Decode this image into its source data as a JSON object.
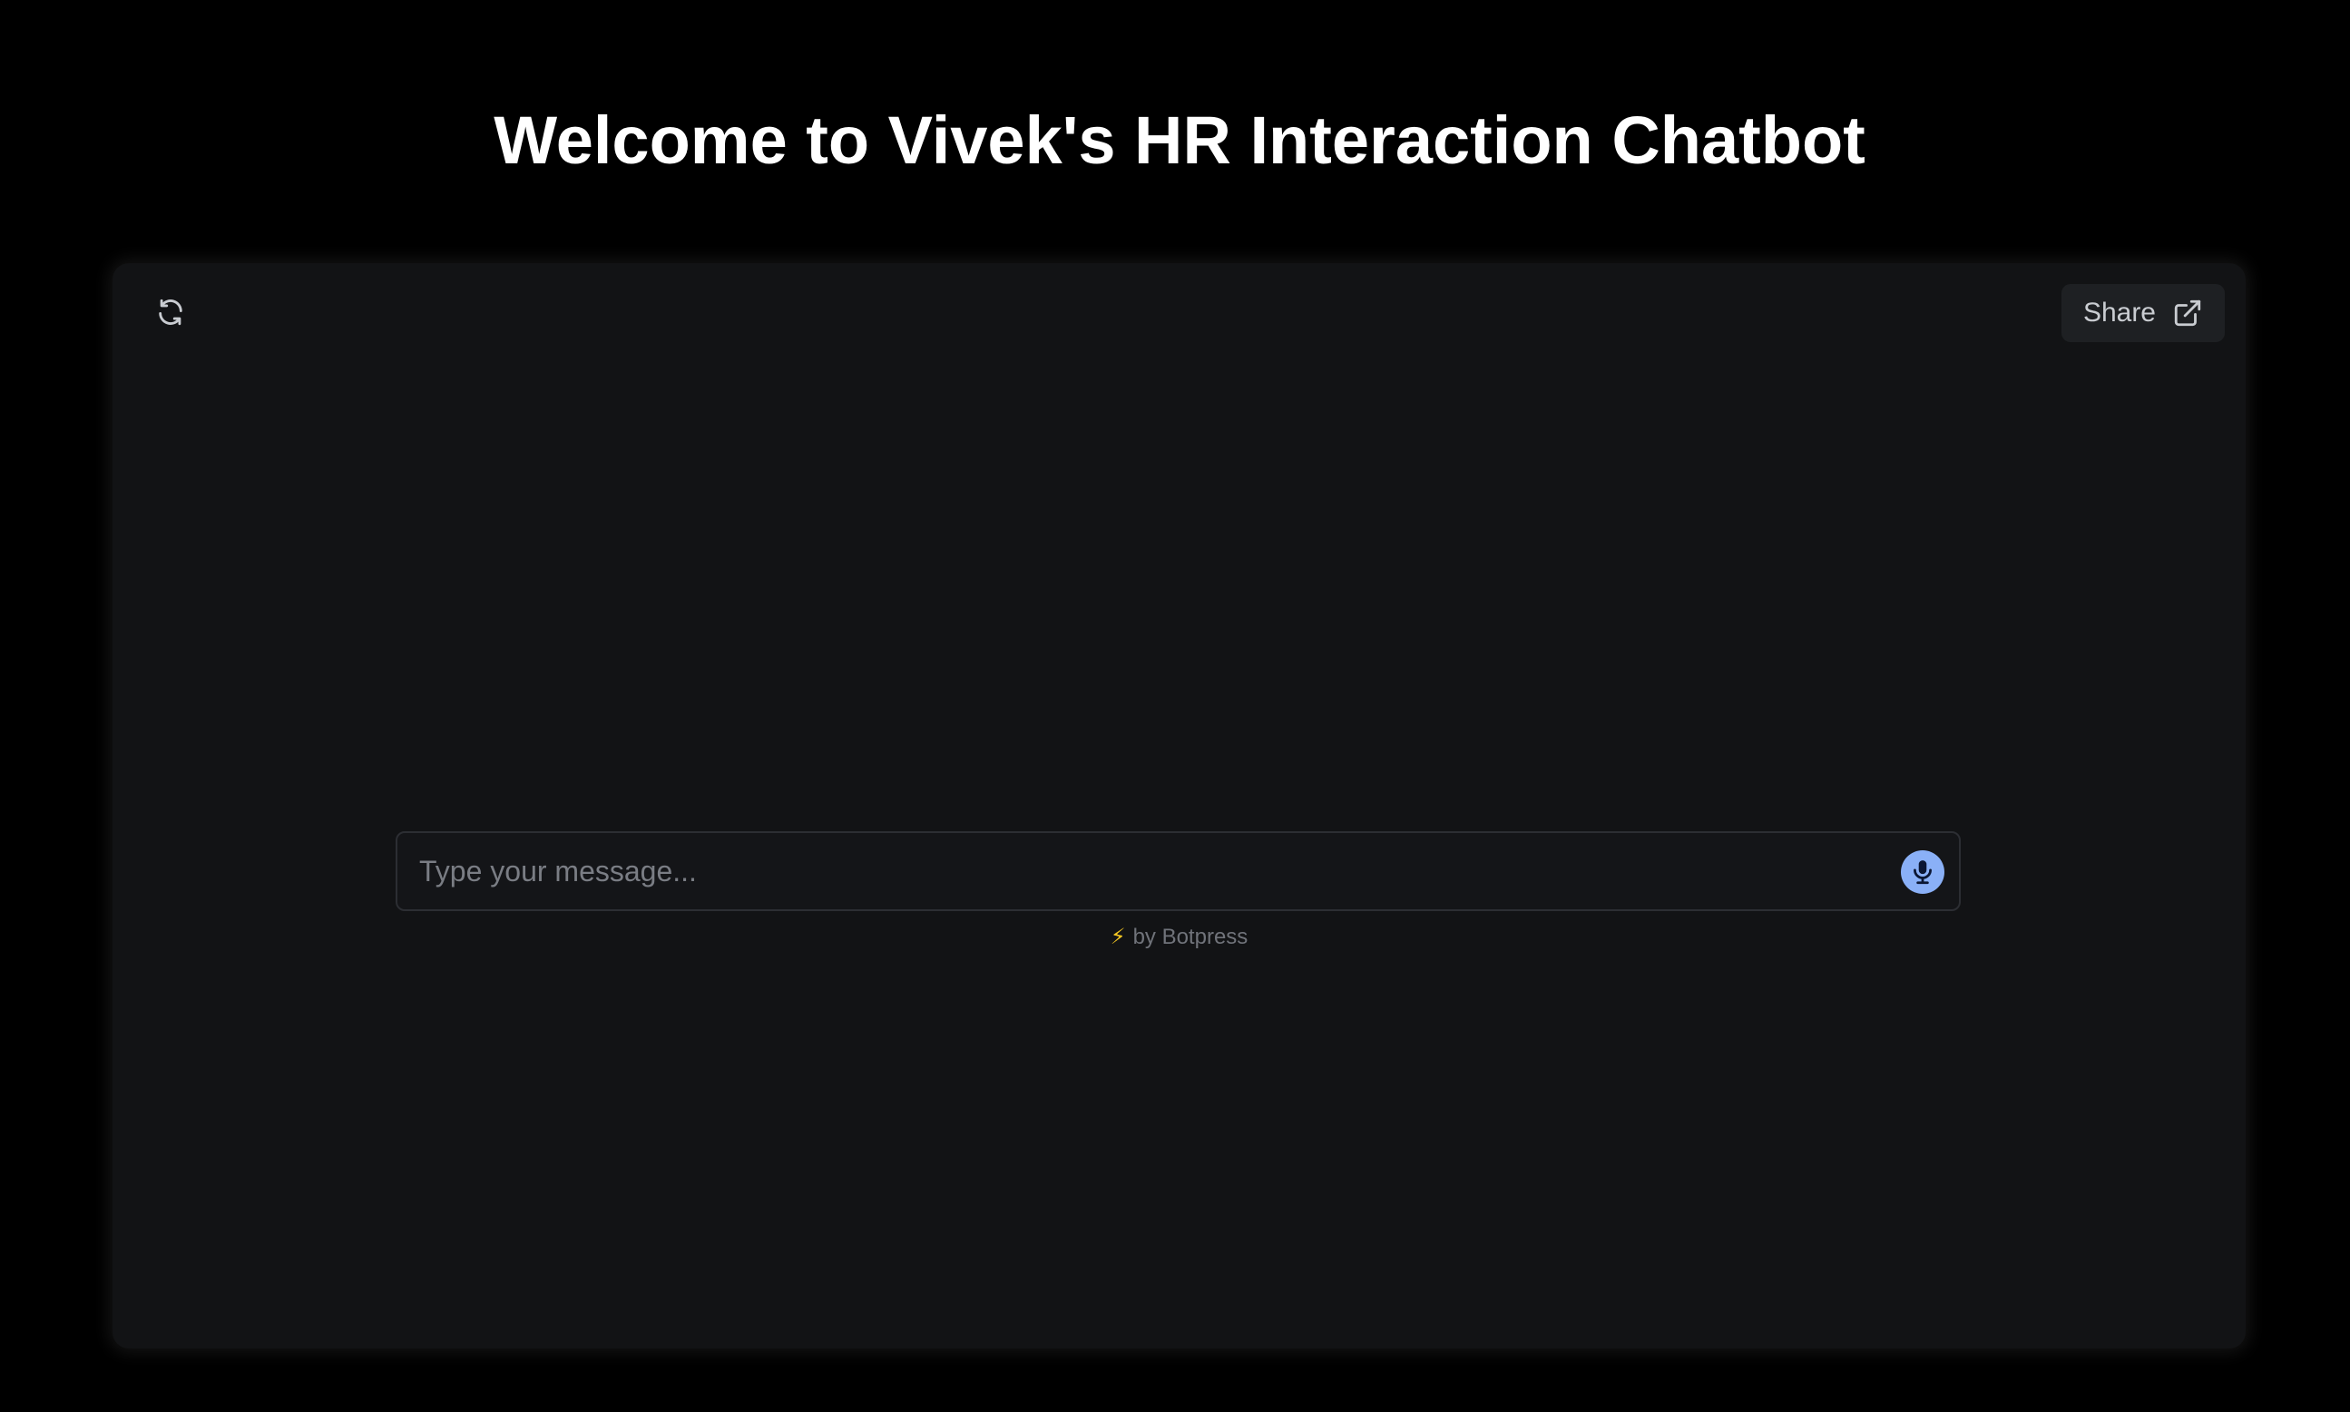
{
  "page": {
    "title": "Welcome to Vivek's HR Interaction Chatbot"
  },
  "chat": {
    "refresh_icon": "refresh-icon",
    "share_label": "Share",
    "share_icon": "external-link-icon",
    "input_placeholder": "Type your message...",
    "input_value": "",
    "mic_icon": "microphone-icon",
    "powered_by_text": "by Botpress",
    "powered_by_icon": "lightning-bolt-icon"
  },
  "colors": {
    "background": "#000000",
    "panel": "#121315",
    "accent": "#8ab0f7",
    "bolt": "#f3c623"
  }
}
